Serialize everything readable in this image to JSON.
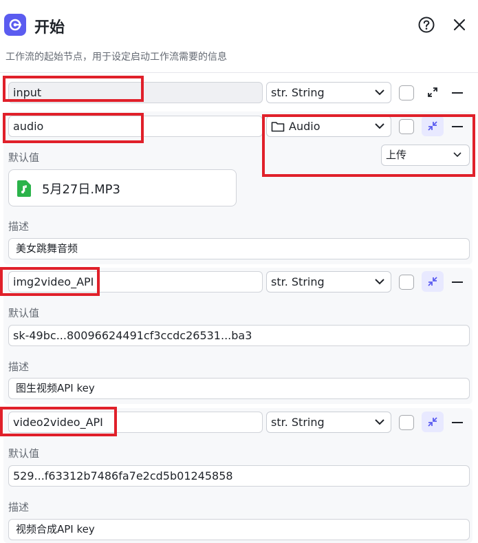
{
  "header": {
    "title": "开始",
    "subtitle": "工作流的起始节点，用于设定启动工作流需要的信息",
    "help_icon": "question-circle-icon",
    "close_icon": "close-icon",
    "logo_icon": "start-node-icon",
    "accent_color": "#5b5cf0"
  },
  "params": [
    {
      "name": "input",
      "type": "str. String",
      "expand_icon": "expand-icon"
    },
    {
      "name": "audio",
      "type": "Audio",
      "type_icon": "folder-icon",
      "collapse_icon": "collapse-icon",
      "upload_mode": "上传",
      "default_label": "默认值",
      "default_file": "5月27日.MP3",
      "file_icon": "music-file-icon",
      "desc_label": "描述",
      "description": "美女跳舞音频"
    },
    {
      "name": "img2video_API",
      "type": "str. String",
      "collapse_icon": "collapse-icon",
      "default_label": "默认值",
      "default_value": "sk-49bc...80096624491cf3ccdc26531...ba3",
      "desc_label": "描述",
      "description": "图生视频API key"
    },
    {
      "name": "video2video_API",
      "type": "str. String",
      "collapse_icon": "collapse-icon",
      "default_label": "默认值",
      "default_value": "529...f63312b7486fa7e2cd5b01245858",
      "desc_label": "描述",
      "description": "视频合成API key"
    }
  ],
  "highlight_color": "#e0202a"
}
